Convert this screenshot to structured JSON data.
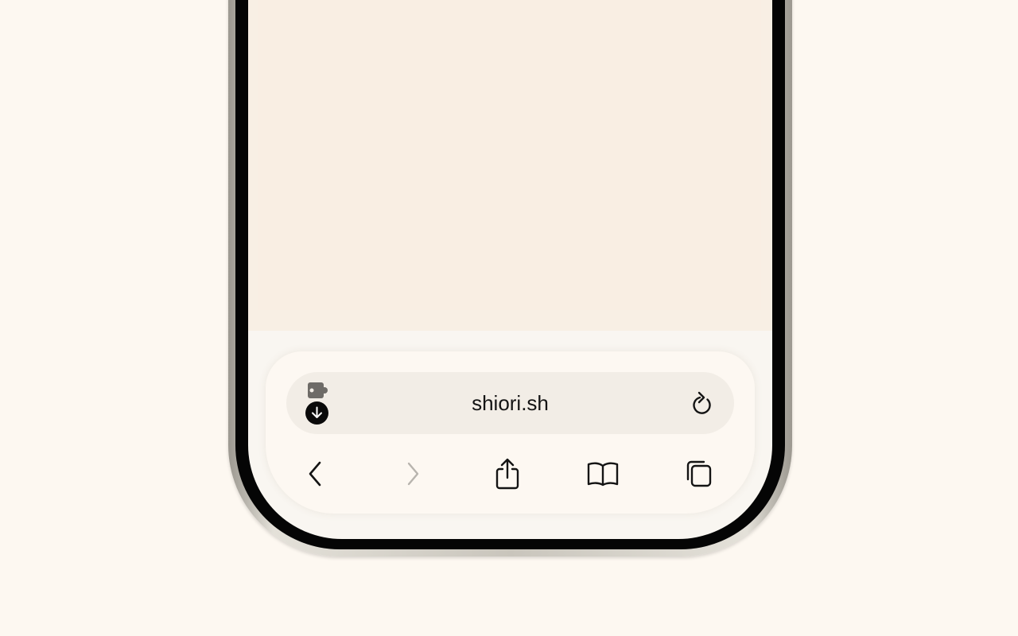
{
  "address_bar": {
    "url": "shiori.sh"
  },
  "icons": {
    "extension": "puzzle-extension-icon",
    "download": "download-arrow-icon",
    "reload": "reload-icon",
    "back": "chevron-left-icon",
    "forward": "chevron-right-icon",
    "share": "share-icon",
    "bookmarks": "book-icon",
    "tabs": "tabs-icon"
  },
  "colors": {
    "background": "#fdf8f1",
    "page_content": "#f8efe4",
    "toolbar": "#fdf8f2",
    "address_bar": "#f2ede6",
    "icon": "#141414",
    "icon_disabled": "#b8b4ae"
  }
}
